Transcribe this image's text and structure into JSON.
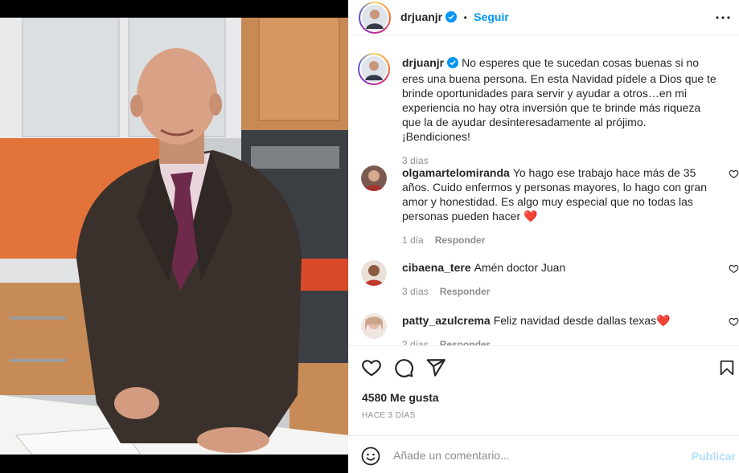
{
  "post": {
    "author": "drjuanjr",
    "follow_label": "Seguir",
    "separator": "•",
    "caption": "No esperes que te sucedan cosas buenas si no eres una buena persona. En esta Navidad pídele a Dios que te brinde oportunidades para servir y ayudar a otros…en mi experiencia no hay otra inversión que te brinde más riqueza que la de ayudar desinteresadamente al prójimo. ¡Bendiciones!",
    "caption_time": "3 días"
  },
  "comments": [
    {
      "user": "olgamartelomiranda",
      "text": "Yo hago ese trabajo hace más de 35 años. Cuido enfermos y personas mayores, lo hago con gran amor y honestidad. Es algo muy especial que no todas las personas pueden hacer",
      "emoji": "❤️",
      "time": "1 día",
      "reply": "Responder"
    },
    {
      "user": "cibaena_tere",
      "text": "Amén doctor Juan",
      "time": "3 días",
      "reply": "Responder"
    },
    {
      "user": "patty_azulcrema",
      "text": "Feliz navidad desde dallas texas",
      "emoji": "❤️",
      "time": "2 días",
      "reply": "Responder"
    }
  ],
  "stats": {
    "likes": "4580 Me gusta",
    "date": "HACE 3 DÍAS"
  },
  "composer": {
    "placeholder": "Añade un comentario...",
    "publish_label": "Publicar"
  },
  "icons": {
    "header": [
      "verified-badge-icon",
      "more-options-icon"
    ],
    "actions": [
      "like-heart-icon",
      "comment-icon",
      "share-icon",
      "save-bookmark-icon"
    ],
    "composer": [
      "emoji-icon"
    ]
  },
  "colors": {
    "accent": "#0095f6",
    "publish_disabled": "#b2dffc",
    "heart": "#ed4956",
    "secondary_text": "#8e8e8e"
  }
}
